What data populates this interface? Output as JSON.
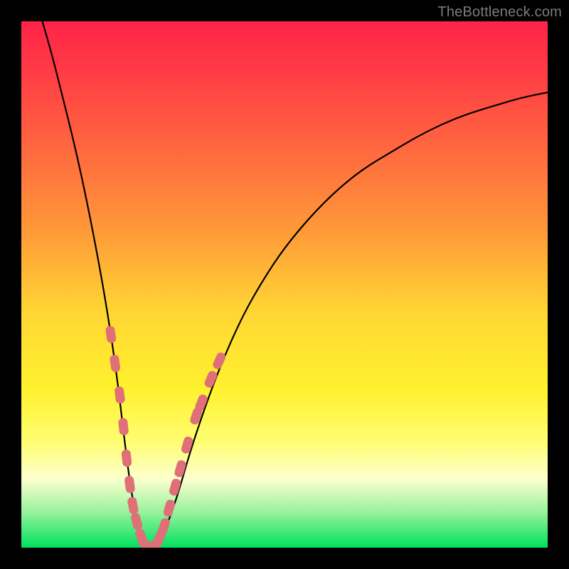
{
  "watermark": "TheBottleneck.com",
  "chart_data": {
    "type": "line",
    "title": "",
    "xlabel": "",
    "ylabel": "",
    "xlim": [
      0,
      100
    ],
    "ylim": [
      0,
      100
    ],
    "grid": false,
    "legend": false,
    "series": [
      {
        "name": "bottleneck-curve",
        "x": [
          4,
          6,
          8,
          10,
          12,
          14,
          16,
          18,
          20,
          21,
          22,
          23,
          24,
          25,
          26,
          28,
          30,
          32,
          35,
          38,
          42,
          46,
          50,
          55,
          60,
          65,
          70,
          75,
          80,
          85,
          90,
          95,
          100
        ],
        "y": [
          100,
          93,
          85,
          77,
          68,
          58,
          47,
          34,
          17,
          10,
          5,
          1,
          0,
          0,
          1,
          5,
          11,
          18,
          27,
          35,
          44,
          51,
          57,
          63,
          68,
          72,
          75,
          78,
          80.5,
          82.5,
          84,
          85.5,
          86.5
        ],
        "color": "#000000",
        "stroke_width": 2.2
      }
    ],
    "markers": [
      {
        "name": "highlight-beads",
        "note": "pink rounded markers clustered near bottleneck minimum",
        "color": "#e07078",
        "points": [
          {
            "x": 17.0,
            "y": 40.5
          },
          {
            "x": 17.8,
            "y": 35.0
          },
          {
            "x": 18.7,
            "y": 29.0
          },
          {
            "x": 19.4,
            "y": 23.0
          },
          {
            "x": 20.0,
            "y": 17.0
          },
          {
            "x": 20.6,
            "y": 12.0
          },
          {
            "x": 21.2,
            "y": 8.0
          },
          {
            "x": 21.9,
            "y": 5.0
          },
          {
            "x": 22.8,
            "y": 2.0
          },
          {
            "x": 23.6,
            "y": 0.5
          },
          {
            "x": 24.5,
            "y": 0.2
          },
          {
            "x": 25.4,
            "y": 0.5
          },
          {
            "x": 26.2,
            "y": 1.8
          },
          {
            "x": 27.1,
            "y": 4.0
          },
          {
            "x": 28.1,
            "y": 7.5
          },
          {
            "x": 29.2,
            "y": 11.5
          },
          {
            "x": 30.2,
            "y": 15.0
          },
          {
            "x": 31.5,
            "y": 19.5
          },
          {
            "x": 33.2,
            "y": 25.0
          },
          {
            "x": 34.2,
            "y": 27.5
          },
          {
            "x": 36.0,
            "y": 32.0
          },
          {
            "x": 37.6,
            "y": 35.5
          }
        ]
      }
    ],
    "background_gradient": {
      "direction": "vertical",
      "stops": [
        {
          "pos": 0,
          "color": "#ff2348"
        },
        {
          "pos": 55,
          "color": "#ffd534"
        },
        {
          "pos": 100,
          "color": "#00e05e"
        }
      ]
    }
  }
}
